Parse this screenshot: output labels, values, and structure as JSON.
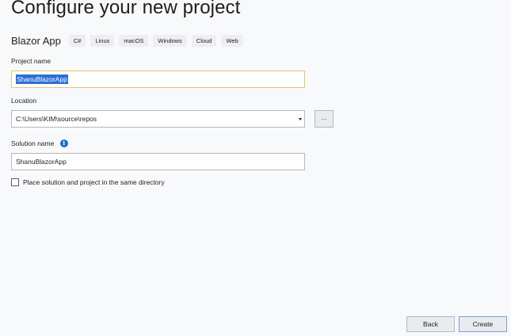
{
  "header": {
    "title": "Configure your new project"
  },
  "template": {
    "name": "Blazor App",
    "tags": [
      "C#",
      "Linux",
      "macOS",
      "Windows",
      "Cloud",
      "Web"
    ]
  },
  "project_name": {
    "label": "Project name",
    "value": "ShanuBlazorApp"
  },
  "location": {
    "label": "Location",
    "value": "C:\\Users\\KIM\\source\\repos",
    "browse_label": "..."
  },
  "solution_name": {
    "label": "Solution name",
    "info_glyph": "i",
    "value": "ShanuBlazorApp"
  },
  "same_directory": {
    "label": "Place solution and project in the same directory",
    "checked": false
  },
  "footer": {
    "back_label": "Back",
    "create_label": "Create"
  },
  "colors": {
    "accent": "#2c6fd5",
    "info": "#1c6dd0",
    "focus_border": "#e4c66c"
  },
  "icons": {
    "info": "info-icon",
    "dropdown": "chevron-down-icon"
  }
}
